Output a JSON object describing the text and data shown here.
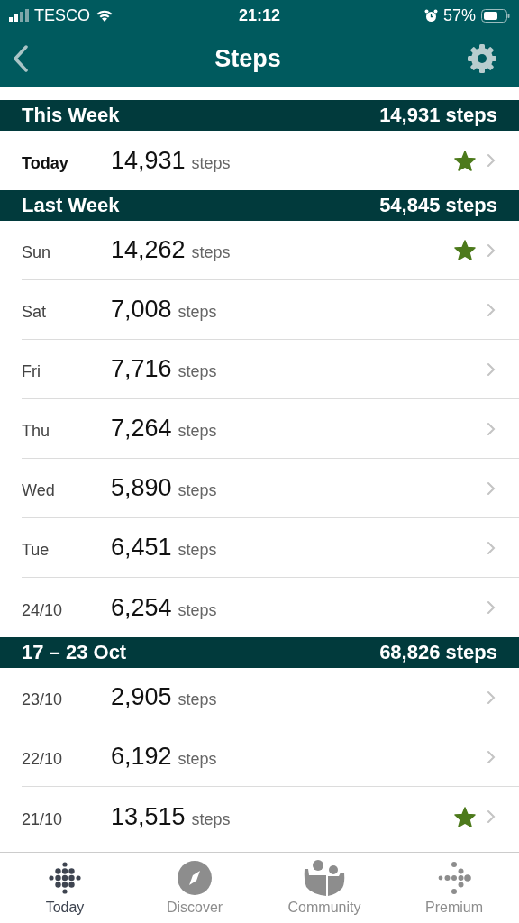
{
  "status_bar": {
    "carrier": "TESCO",
    "time": "21:12",
    "battery": "57%"
  },
  "header": {
    "title": "Steps"
  },
  "sections": [
    {
      "title": "This Week",
      "total": "14,931 steps",
      "rows": [
        {
          "kind": "today",
          "day": "Today",
          "count": "14,931",
          "unit": "steps",
          "goal_met": true
        }
      ]
    },
    {
      "title": "Last Week",
      "total": "54,845 steps",
      "rows": [
        {
          "kind": "day",
          "day": "Sun",
          "count": "14,262",
          "unit": "steps",
          "goal_met": true
        },
        {
          "kind": "day",
          "day": "Sat",
          "count": "7,008",
          "unit": "steps",
          "goal_met": false
        },
        {
          "kind": "day",
          "day": "Fri",
          "count": "7,716",
          "unit": "steps",
          "goal_met": false
        },
        {
          "kind": "day",
          "day": "Thu",
          "count": "7,264",
          "unit": "steps",
          "goal_met": false
        },
        {
          "kind": "day",
          "day": "Wed",
          "count": "5,890",
          "unit": "steps",
          "goal_met": false
        },
        {
          "kind": "day",
          "day": "Tue",
          "count": "6,451",
          "unit": "steps",
          "goal_met": false
        },
        {
          "kind": "day",
          "day": "24/10",
          "count": "6,254",
          "unit": "steps",
          "goal_met": false
        }
      ]
    },
    {
      "title": "17 – 23 Oct",
      "total": "68,826 steps",
      "rows": [
        {
          "kind": "day",
          "day": "23/10",
          "count": "2,905",
          "unit": "steps",
          "goal_met": false
        },
        {
          "kind": "day",
          "day": "22/10",
          "count": "6,192",
          "unit": "steps",
          "goal_met": false
        },
        {
          "kind": "day",
          "day": "21/10",
          "count": "13,515",
          "unit": "steps",
          "goal_met": true
        }
      ]
    }
  ],
  "tab_bar": [
    {
      "kind": "today",
      "label": "Today",
      "selected": true
    },
    {
      "kind": "discover",
      "label": "Discover",
      "selected": false
    },
    {
      "kind": "community",
      "label": "Community",
      "selected": false
    },
    {
      "kind": "premium",
      "label": "Premium",
      "selected": false
    }
  ]
}
